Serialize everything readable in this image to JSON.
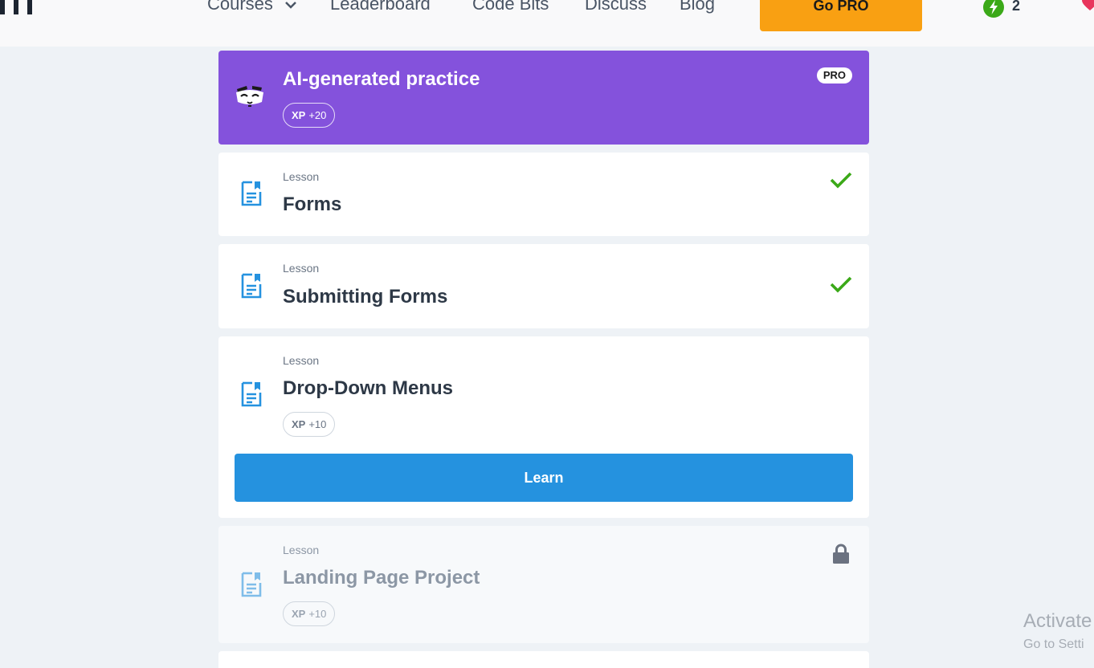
{
  "nav": {
    "links": [
      "Courses",
      "Leaderboard",
      "Code Bits",
      "Discuss",
      "Blog"
    ],
    "go_pro": "Go PRO",
    "streak_count": "2"
  },
  "practice": {
    "title": "AI-generated practice",
    "badge": "PRO",
    "xp_label": "XP",
    "xp_value": "+20"
  },
  "lessons": [
    {
      "label": "Lesson",
      "title": "Forms",
      "status": "completed"
    },
    {
      "label": "Lesson",
      "title": "Submitting Forms",
      "status": "completed"
    },
    {
      "label": "Lesson",
      "title": "Drop-Down Menus",
      "status": "current",
      "xp_label": "XP",
      "xp_value": "+10",
      "action": "Learn"
    },
    {
      "label": "Lesson",
      "title": "Landing Page Project",
      "status": "locked",
      "xp_label": "XP",
      "xp_value": "+10"
    }
  ],
  "watermark": {
    "line1": "Activate",
    "line2": "Go to Setti"
  },
  "colors": {
    "pro_purple": "#8452dc",
    "go_pro_orange": "#f9a012",
    "learn_blue": "#2592df",
    "check_green": "#3ba918"
  },
  "icons": [
    "logo-icon",
    "chevron-down-icon",
    "lightning-icon",
    "heart-icon",
    "mascot-face-icon",
    "lesson-document-icon",
    "checkmark-icon",
    "lock-icon"
  ]
}
